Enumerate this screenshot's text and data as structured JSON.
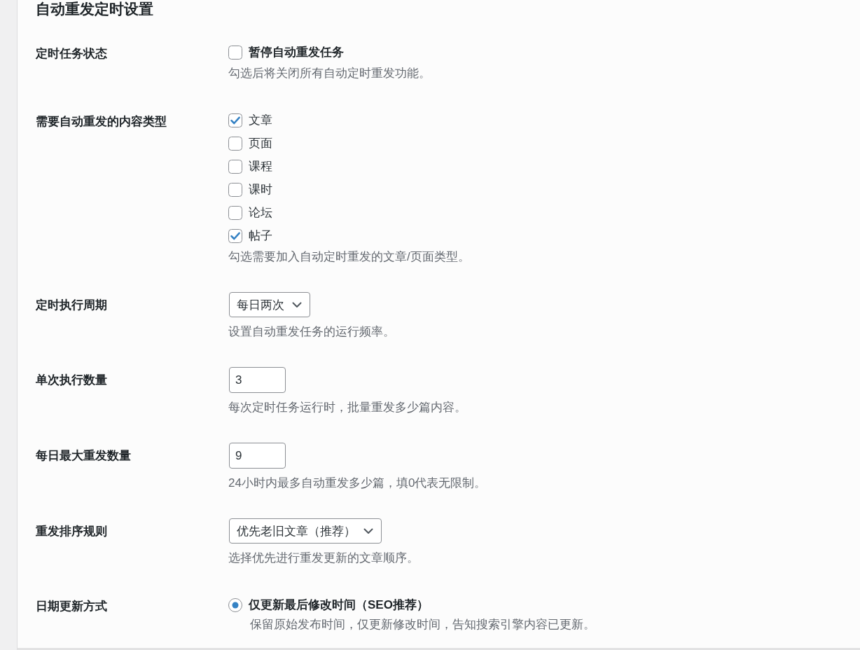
{
  "title": "自动重发定时设置",
  "settings": [
    {
      "label": "定时任务状态",
      "kind": "toggle",
      "options": [
        {
          "label": "暂停自动重发任务",
          "checked": false
        }
      ],
      "description": "勾选后将关闭所有自动定时重发功能。"
    },
    {
      "label": "需要自动重发的内容类型",
      "kind": "checkboxes",
      "options": [
        {
          "label": "文章",
          "checked": true
        },
        {
          "label": "页面",
          "checked": false
        },
        {
          "label": "课程",
          "checked": false
        },
        {
          "label": "课时",
          "checked": false
        },
        {
          "label": "论坛",
          "checked": false
        },
        {
          "label": "帖子",
          "checked": true
        }
      ],
      "description": "勾选需要加入自动定时重发的文章/页面类型。"
    },
    {
      "label": "定时执行周期",
      "kind": "select",
      "value": "每日两次",
      "description": "设置自动重发任务的运行频率。"
    },
    {
      "label": "单次执行数量",
      "kind": "number",
      "value": "3",
      "description": "每次定时任务运行时，批量重发多少篇内容。"
    },
    {
      "label": "每日最大重发数量",
      "kind": "number",
      "value": "9",
      "description": "24小时内最多自动重发多少篇，填0代表无限制。"
    },
    {
      "label": "重发排序规则",
      "kind": "select",
      "value": "优先老旧文章（推荐）",
      "description": "选择优先进行重发更新的文章顺序。"
    },
    {
      "label": "日期更新方式",
      "kind": "radio",
      "options": [
        {
          "label": "仅更新最后修改时间（SEO推荐）",
          "selected": true,
          "description": "保留原始发布时间，仅更新修改时间，告知搜索引擎内容已更新。"
        }
      ]
    }
  ]
}
